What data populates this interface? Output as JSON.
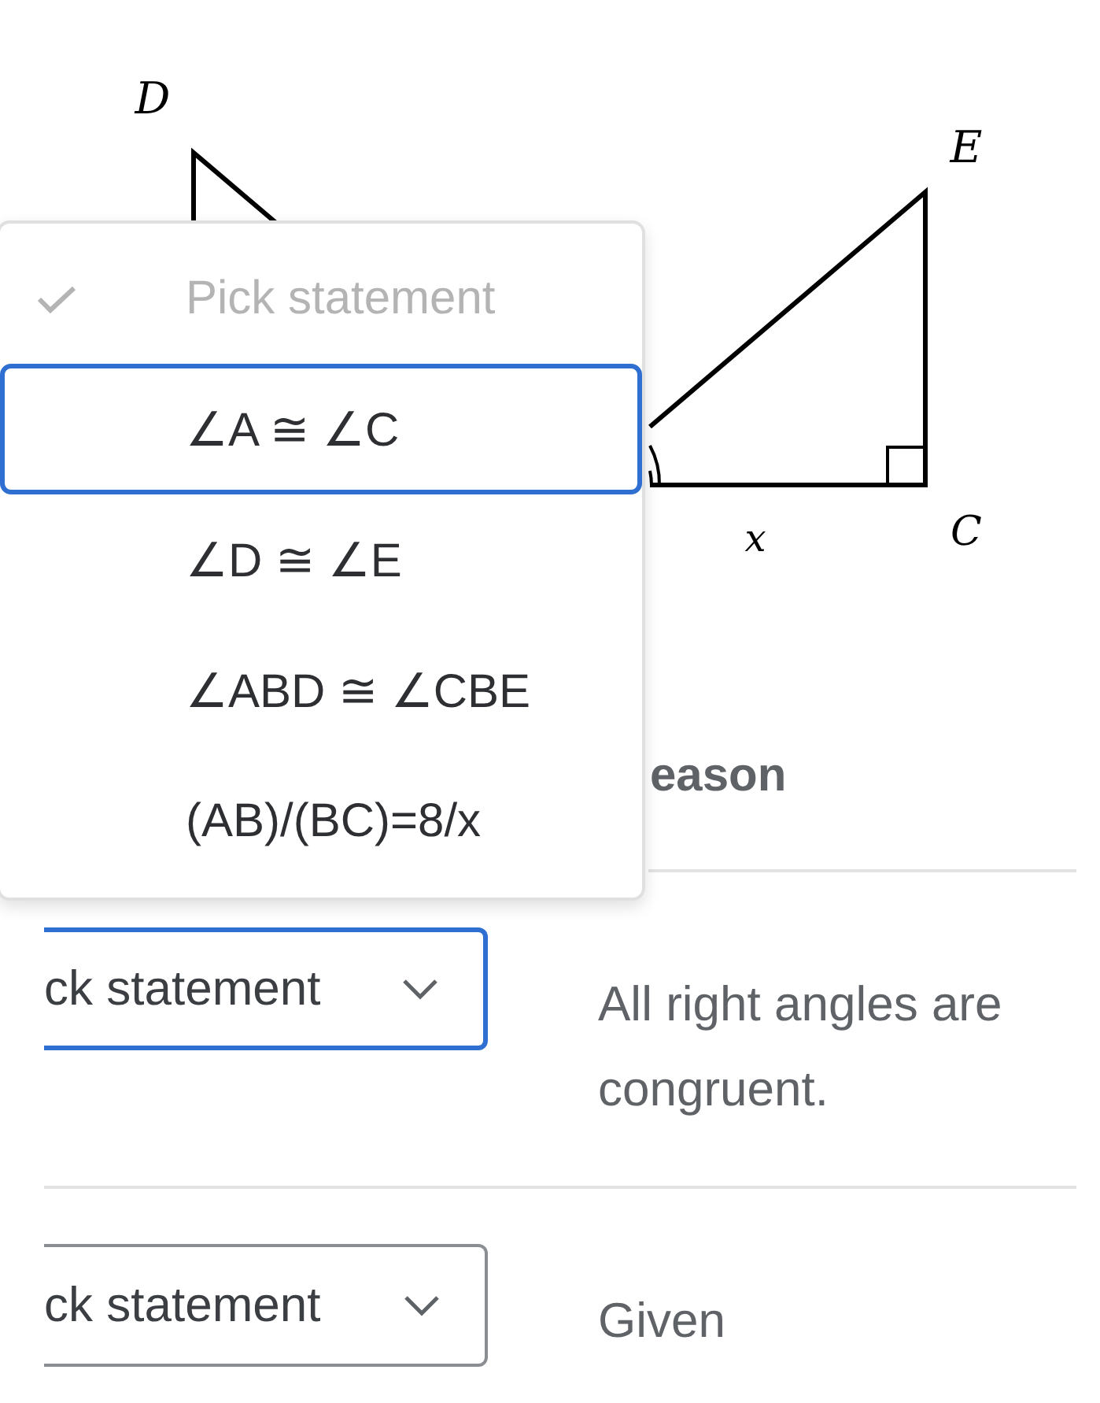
{
  "figure": {
    "labels": [
      {
        "text": "D"
      },
      {
        "text": "E"
      },
      {
        "text": "C"
      },
      {
        "text": "x"
      }
    ]
  },
  "menu": {
    "options": [
      {
        "text": "Pick statement",
        "placeholder": true,
        "checked": true,
        "selected": false
      },
      {
        "text": "∠A ≅ ∠C",
        "placeholder": false,
        "checked": false,
        "selected": true
      },
      {
        "text": "∠D ≅ ∠E",
        "placeholder": false,
        "checked": false,
        "selected": false
      },
      {
        "text": "∠ABD ≅ ∠CBE",
        "placeholder": false,
        "checked": false,
        "selected": false
      },
      {
        "text": "(AB)/(BC)=8/x",
        "placeholder": false,
        "checked": false,
        "selected": false
      }
    ]
  },
  "table": {
    "header": {
      "reason": "eason"
    },
    "rows": [
      {
        "statement": "ck statement",
        "focused": true,
        "reason": "All right angles are congruent."
      },
      {
        "statement": "ck statement",
        "focused": false,
        "reason": "Given"
      }
    ]
  }
}
